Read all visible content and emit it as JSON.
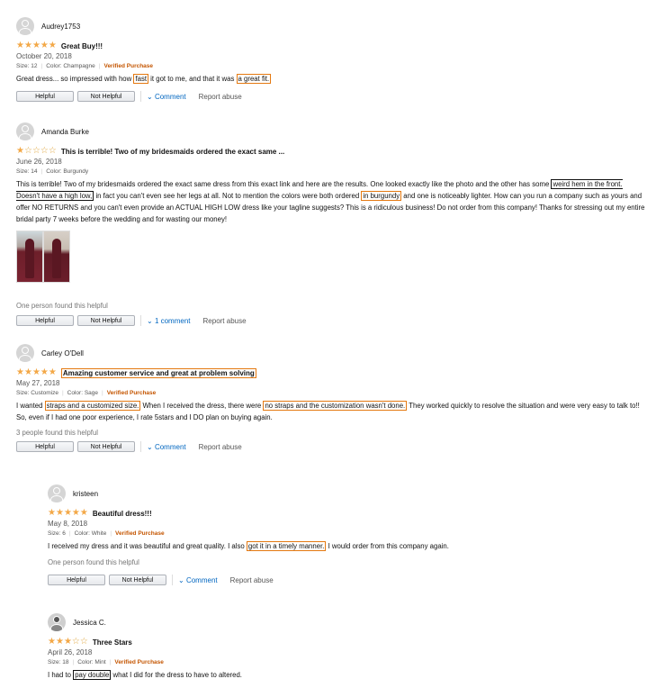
{
  "reviews": [
    {
      "user": "Audrey1753",
      "stars": 5,
      "title": "Great Buy!!!",
      "date": "October 20, 2018",
      "size": "Size: 12",
      "color": "Color: Champagne",
      "verified": "Verified Purchase",
      "body": [
        "Great dress... so impressed with how ",
        "fast",
        " it got to me, and that it was ",
        "a great fit."
      ],
      "helpful_btn": "Helpful",
      "not_helpful_btn": "Not Helpful",
      "comment": "Comment",
      "report": "Report abuse"
    },
    {
      "user": "Amanda Burke",
      "stars": 1,
      "title": "This is terrible! Two of my bridesmaids ordered the exact same ...",
      "date": "June 26, 2018",
      "size": "Size: 14",
      "color": "Color: Burgundy",
      "body": [
        "This is terrible! Two of my bridesmaids ordered the exact same dress from this exact link and here are the results. One looked exactly like the photo and the other has some ",
        "weird hem in the front. Doesn't have a high low,",
        " in fact you can't even see her legs at all. Not to mention the colors were both ordered ",
        "in burgundy",
        " and one is noticeably lighter. How can you run a company such as yours and offer NO RETURNS and you can't even provide an ACTUAL HIGH LOW dress like your tagline suggests? This is a ridiculous business! Do not order from this company! Thanks for stressing out my entire bridal party 7 weeks before the wedding and for wasting our money!"
      ],
      "helpful_count": "One person found this helpful",
      "helpful_btn": "Helpful",
      "not_helpful_btn": "Not Helpful",
      "comment": "1 comment",
      "report": "Report abuse"
    },
    {
      "user": "Carley O'Dell",
      "stars": 5,
      "title": "Amazing customer service and great at problem solving",
      "date": "May 27, 2018",
      "size": "Size: Customize",
      "color": "Color: Sage",
      "verified": "Verified Purchase",
      "body": [
        "I wanted ",
        "straps and a customized size.",
        " When I received the dress, there were ",
        "no straps and the customization wasn't done.",
        " They worked quickly to resolve the situation and were very easy to talk to!! So, even if I had one poor experience, I rate 5stars and I DO plan on buying again."
      ],
      "helpful_count": "3 people found this helpful",
      "helpful_btn": "Helpful",
      "not_helpful_btn": "Not Helpful",
      "comment": "Comment",
      "report": "Report abuse"
    },
    {
      "user": "kristeen",
      "stars": 5,
      "title": "Beautiful dress!!!",
      "date": "May 8, 2018",
      "size": "Size: 6",
      "color": "Color: White",
      "verified": "Verified Purchase",
      "body": [
        "I received my dress and it was beautiful and great quality. I also ",
        "got it in a timely manner.",
        " I would order from this company again."
      ],
      "helpful_count": "One person found this helpful",
      "helpful_btn": "Helpful",
      "not_helpful_btn": "Not Helpful",
      "comment": "Comment",
      "report": "Report abuse"
    },
    {
      "user": "Jessica C.",
      "stars": 3,
      "title": "Three Stars",
      "date": "April 26, 2018",
      "size": "Size: 18",
      "color": "Color: Mint",
      "verified": "Verified Purchase",
      "body": [
        "I had to ",
        "pay double",
        " what I did for the dress to have to altered."
      ]
    }
  ],
  "icons": {
    "star_filled": "★",
    "star_empty": "☆",
    "chevron": "⌄"
  },
  "colors": {
    "star": "#f3a847",
    "verified": "#c45500",
    "link": "#0066c0",
    "highlight": "#e47911"
  }
}
